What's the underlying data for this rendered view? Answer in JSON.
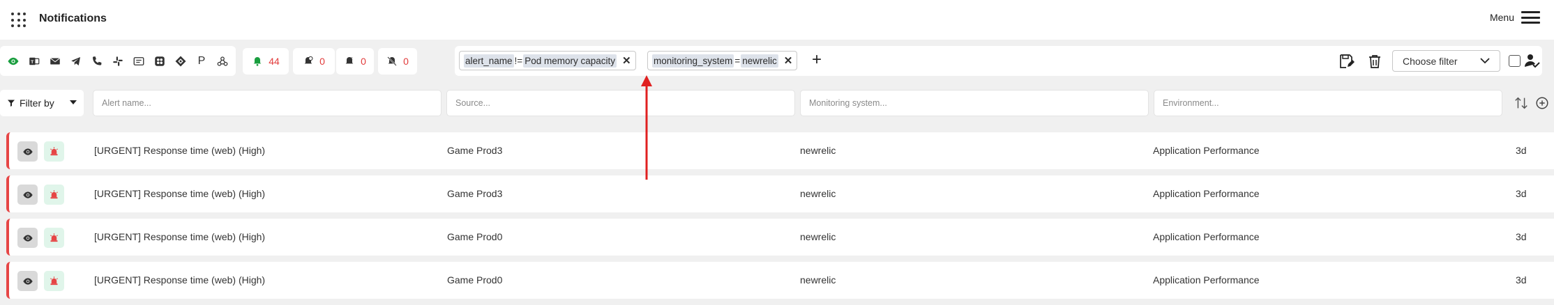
{
  "header": {
    "title": "Notifications",
    "menu_label": "Menu"
  },
  "channels": [
    {
      "name": "eye-icon",
      "glyph": "",
      "active": true
    },
    {
      "name": "teams-icon",
      "glyph": ""
    },
    {
      "name": "email-icon",
      "glyph": ""
    },
    {
      "name": "telegram-icon",
      "glyph": ""
    },
    {
      "name": "phone-icon",
      "glyph": ""
    },
    {
      "name": "slack-icon",
      "glyph": ""
    },
    {
      "name": "sms-icon",
      "glyph": ""
    },
    {
      "name": "box-icon",
      "glyph": ""
    },
    {
      "name": "jira-icon",
      "glyph": ""
    },
    {
      "name": "pagerduty-icon",
      "glyph": "P"
    },
    {
      "name": "webhook-icon",
      "glyph": ""
    }
  ],
  "counts": {
    "firing": "44",
    "acknowledged": "0",
    "snoozed": "0",
    "muted": "0"
  },
  "filters": [
    {
      "key": "alert_name",
      "op": "!=",
      "value": "Pod memory capacity"
    },
    {
      "key": "monitoring_system",
      "op": "=",
      "value": "newrelic"
    }
  ],
  "filter_select": {
    "placeholder": "Choose filter"
  },
  "search": {
    "filter_by_label": "Filter by",
    "alert_name_placeholder": "Alert name...",
    "source_placeholder": "Source...",
    "monitoring_placeholder": "Monitoring system...",
    "environment_placeholder": "Environment..."
  },
  "rows": [
    {
      "alert": "[URGENT] Response time (web) (High)",
      "source": "Game Prod3",
      "monitoring": "newrelic",
      "environment": "Application Performance",
      "age": "3d"
    },
    {
      "alert": "[URGENT] Response time (web) (High)",
      "source": "Game Prod3",
      "monitoring": "newrelic",
      "environment": "Application Performance",
      "age": "3d"
    },
    {
      "alert": "[URGENT] Response time (web) (High)",
      "source": "Game Prod0",
      "monitoring": "newrelic",
      "environment": "Application Performance",
      "age": "3d"
    },
    {
      "alert": "[URGENT] Response time (web) (High)",
      "source": "Game Prod0",
      "monitoring": "newrelic",
      "environment": "Application Performance",
      "age": "3d"
    }
  ],
  "colors": {
    "accent_red": "#e64545",
    "count_red": "#e23b3b",
    "active_green": "#1a9e3f",
    "arrow_red": "#e02020"
  }
}
